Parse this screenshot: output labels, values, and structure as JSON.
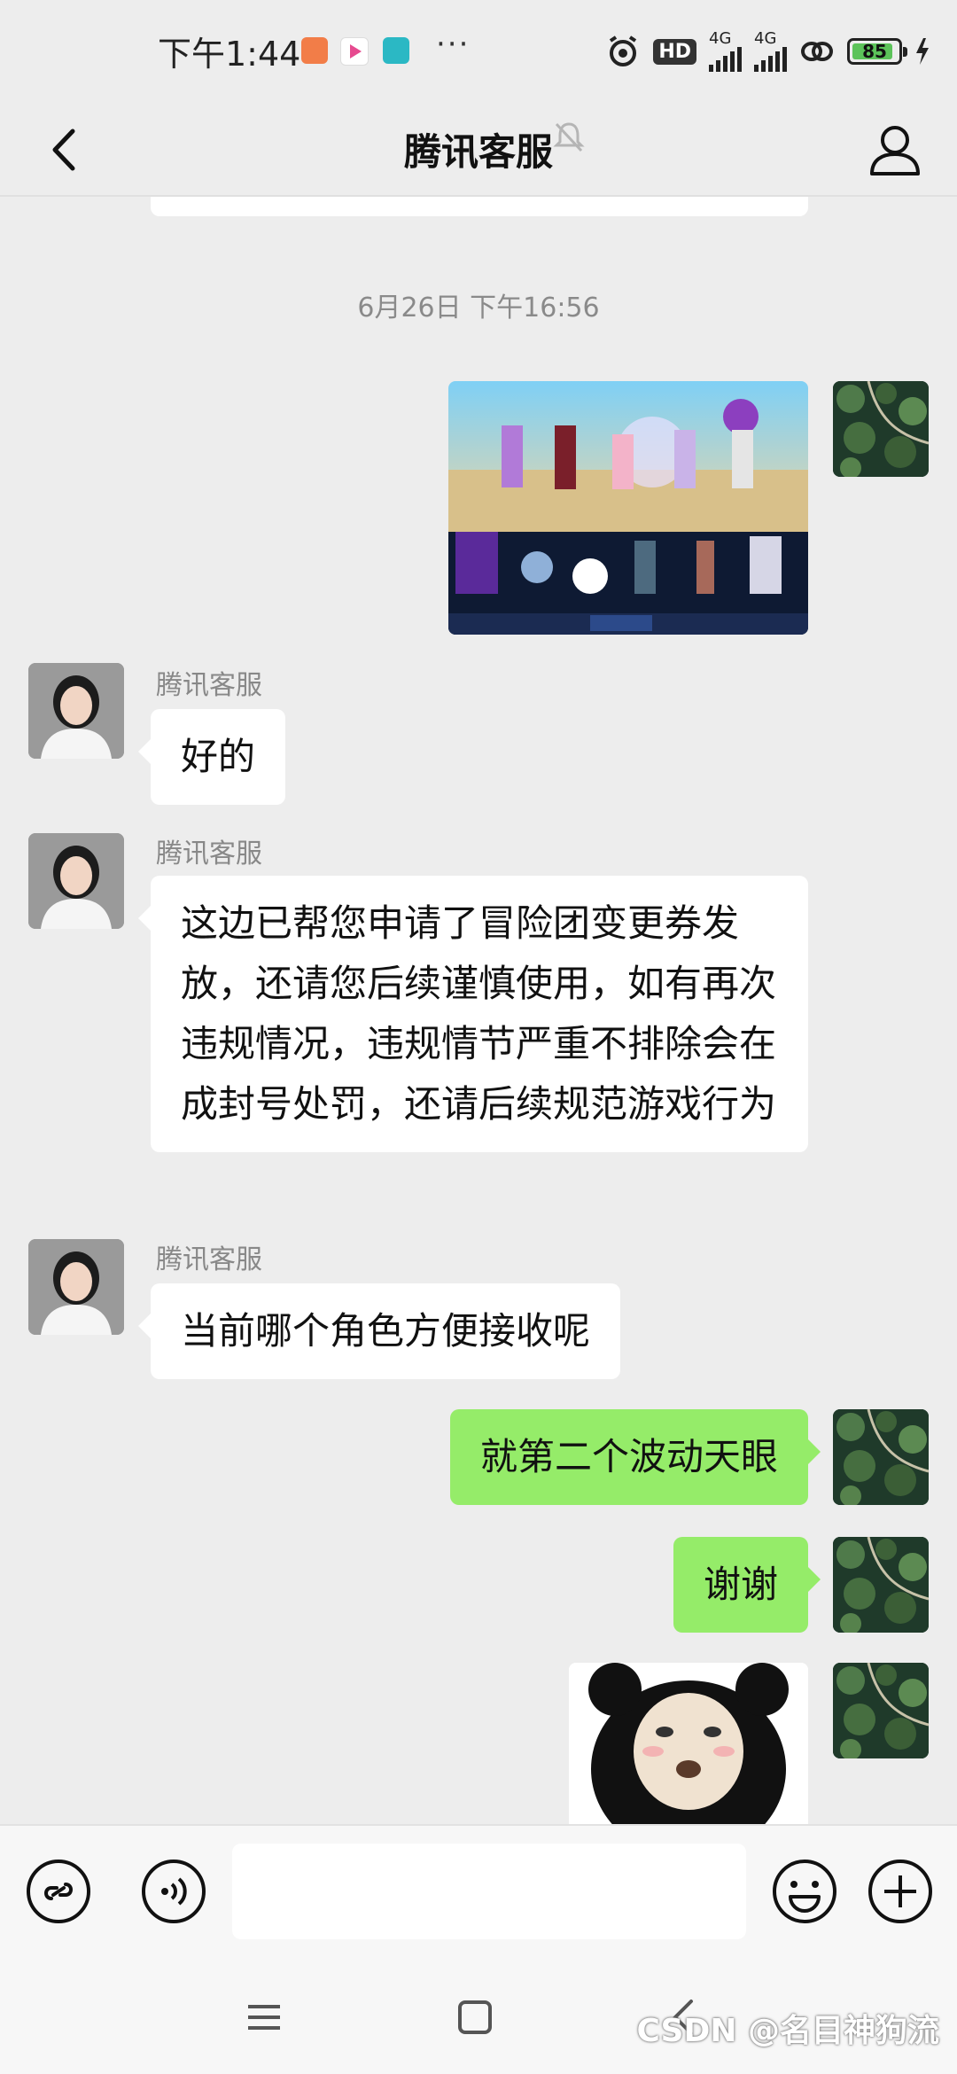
{
  "status_bar": {
    "time": "下午1:44",
    "network_1": "4G",
    "network_2": "4G",
    "battery": "85",
    "hd_badge": "HD"
  },
  "header": {
    "title": "腾讯客服",
    "back_icon": "chevron-left-icon",
    "mute_icon": "bell-off-icon",
    "profile_icon": "person-icon"
  },
  "chat": {
    "timestamp": "6月26日 下午16:56",
    "messages": [
      {
        "type": "image",
        "from": "me",
        "content": "game-screenshot"
      },
      {
        "type": "text",
        "from": "cs",
        "sender": "腾讯客服",
        "text": "好的"
      },
      {
        "type": "text",
        "from": "cs",
        "sender": "腾讯客服",
        "text": "这边已帮您申请了冒险团变更券发放，还请您后续谨慎使用，如有再次违规情况，违规情节严重不排除会在成封号处罚，还请后续规范游戏行为"
      },
      {
        "type": "text",
        "from": "cs",
        "sender": "腾讯客服",
        "text": "当前哪个角色方便接收呢"
      },
      {
        "type": "text",
        "from": "me",
        "text": "就第二个波动天眼"
      },
      {
        "type": "text",
        "from": "me",
        "text": "谢谢"
      },
      {
        "type": "image",
        "from": "me",
        "content": "panda-meme-sticker"
      }
    ]
  },
  "input_bar": {
    "mini_program_icon": "link-icon",
    "voice_icon": "voice-icon",
    "emoji_icon": "emoji-icon",
    "plus_icon": "plus-icon"
  },
  "watermark": "CSDN @名目神狗流"
}
